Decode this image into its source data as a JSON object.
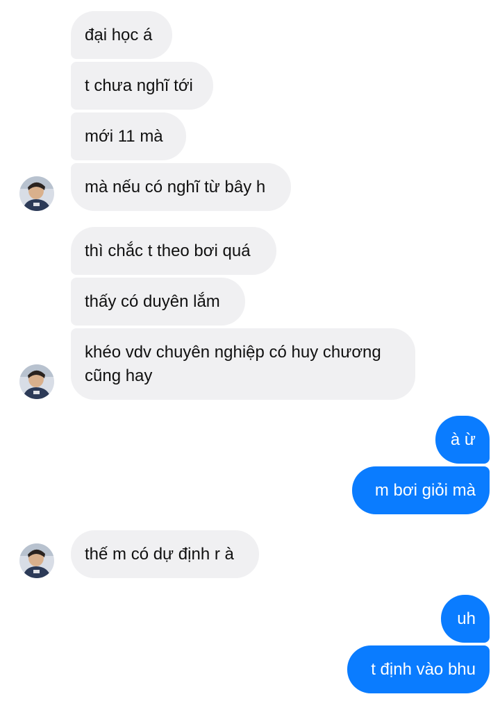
{
  "conversation": {
    "messages": [
      {
        "id": "m1",
        "sender": "other",
        "text": "đại học á"
      },
      {
        "id": "m2",
        "sender": "other",
        "text": "t chưa nghĩ tới"
      },
      {
        "id": "m3",
        "sender": "other",
        "text": "mới 11 mà"
      },
      {
        "id": "m4",
        "sender": "other",
        "text": "mà nếu có nghĩ từ bây h"
      },
      {
        "id": "m5",
        "sender": "other",
        "text": "thì chắc t theo bơi quá"
      },
      {
        "id": "m6",
        "sender": "other",
        "text": "thấy có duyên lắm"
      },
      {
        "id": "m7",
        "sender": "other",
        "text": "khéo vdv chuyên nghiệp có huy chương cũng hay"
      },
      {
        "id": "m8",
        "sender": "me",
        "text": "à ừ"
      },
      {
        "id": "m9",
        "sender": "me",
        "text": "m bơi giỏi mà"
      },
      {
        "id": "m10",
        "sender": "other",
        "text": "thế m có dự định r à"
      },
      {
        "id": "m11",
        "sender": "me",
        "text": "uh"
      },
      {
        "id": "m12",
        "sender": "me",
        "text": "t định vào bhu"
      }
    ]
  },
  "theme": {
    "incoming_bubble": "#f0f0f2",
    "outgoing_bubble": "#0a7cff",
    "outgoing_text": "#ffffff",
    "incoming_text": "#101010"
  }
}
